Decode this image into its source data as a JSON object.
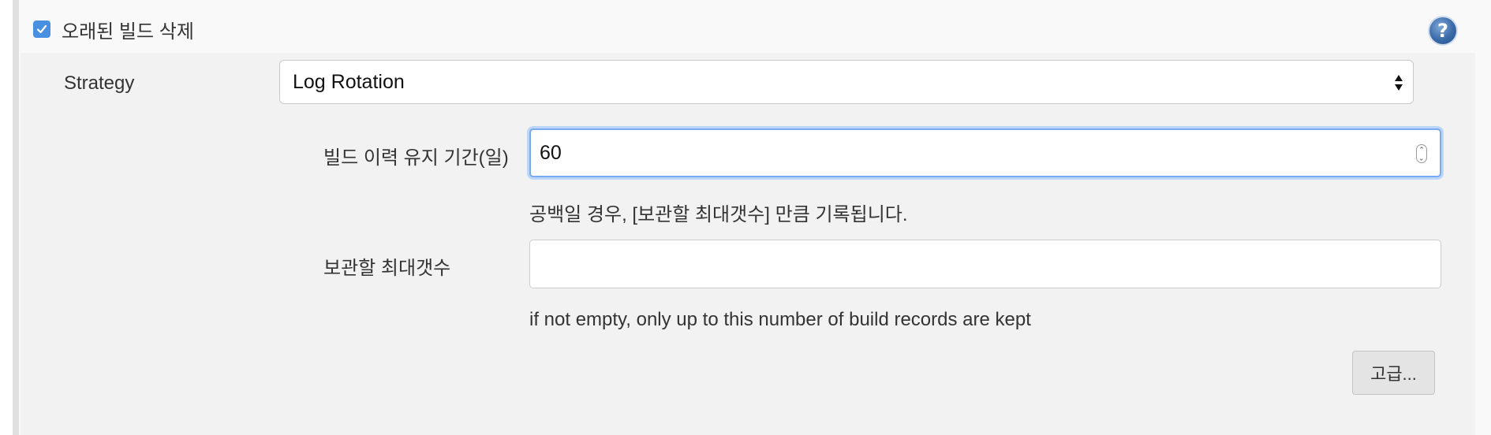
{
  "section": {
    "checkbox_checked": true,
    "title": "오래된 빌드 삭제",
    "help_icon": "question-mark-icon"
  },
  "strategy": {
    "label": "Strategy",
    "selected": "Log Rotation"
  },
  "days_to_keep": {
    "label": "빌드 이력 유지 기간(일)",
    "value": "60",
    "help": "공백일 경우, [보관할 최대갯수] 만큼 기록됩니다."
  },
  "max_to_keep": {
    "label": "보관할 최대갯수",
    "value": "",
    "help": "if not empty, only up to this number of build records are kept"
  },
  "advanced_button": "고급...",
  "colors": {
    "accent": "#4a90e2",
    "focus_ring": "#7aaaf0"
  }
}
